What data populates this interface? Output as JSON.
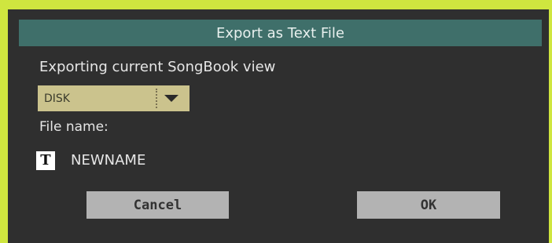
{
  "dialog": {
    "title": "Export as Text File",
    "subtitle": "Exporting current SongBook view",
    "destination": {
      "selected": "DISK",
      "icon": "chevron-down-icon"
    },
    "file_name_label": "File name:",
    "text_icon_glyph": "T",
    "file_name_value": "NEWNAME",
    "buttons": {
      "cancel": "Cancel",
      "ok": "OK"
    }
  },
  "colors": {
    "frame": "#cfe63f",
    "background": "#2f2f2f",
    "titlebar": "#3f6f6a",
    "dropdown": "#cbc38d",
    "button": "#b3b3b3"
  }
}
